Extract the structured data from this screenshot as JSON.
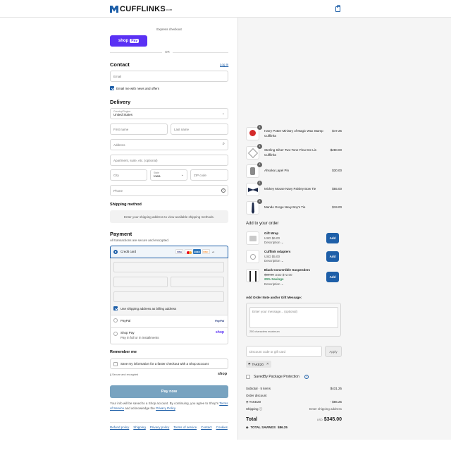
{
  "header": {
    "brand": "CUFFLINKS",
    "trademark": "com",
    "cart_icon": "shopping-bag-icon",
    "brand_color": "#1e5fa8"
  },
  "express": {
    "label": "Express checkout",
    "shop": "shop",
    "pay": "Pay",
    "or": "OR",
    "shop_pay_color": "#5a31f4"
  },
  "contact": {
    "title": "Contact",
    "login": "Log in",
    "email_placeholder": "Email",
    "newsletter": "Email me with news and offers"
  },
  "delivery": {
    "title": "Delivery",
    "country_label": "Country/Region",
    "country": "United States",
    "first_name": "First name",
    "last_name": "Last name",
    "address": "Address",
    "apartment": "Apartment, suite, etc. (optional)",
    "city": "City",
    "state_label": "State",
    "state": "Iowa",
    "zip": "ZIP code",
    "phone": "Phone"
  },
  "shipping": {
    "title": "Shipping method",
    "placeholder": "Enter your shipping address to view available shipping methods."
  },
  "payment": {
    "title": "Payment",
    "subtitle": "All transactions are secure and encrypted.",
    "credit_card": "Credit card",
    "cards": [
      "VISA",
      "MC",
      "AMEX",
      "DISC"
    ],
    "more": "+4",
    "billing": "Use shipping address as billing address",
    "paypal": "PayPal",
    "paypal_logo": "PayPal",
    "shop_pay": "Shop Pay",
    "shop_pay_sub": "Pay in full or in installments",
    "shop_logo": "shop"
  },
  "remember": {
    "title": "Remember me",
    "save": "Save my information for a faster checkout with a Shop account",
    "secure": "Secure and encrypted",
    "shop_logo": "shop"
  },
  "pay_now": "Pay now",
  "legal": {
    "line1": "Your info will be saved to a Shop account. By continuing, you agree to Shop's",
    "terms": "Terms of Service",
    "mid": "and acknowledge the",
    "privacy": "Privacy Policy",
    "end": "."
  },
  "footer": [
    "Refund policy",
    "Shipping",
    "Privacy policy",
    "Terms of service",
    "Contact",
    "Cookies"
  ],
  "order": {
    "items": [
      {
        "name": "Harry Potter Ministry of Magic Wax Stamp",
        "name2": "Cufflinks",
        "qty": "1",
        "price": "$47.25"
      },
      {
        "name": "Sterling Silver Two-Tone Fleur De Lis",
        "name2": "Cufflinks",
        "qty": "1",
        "price": "$280.00"
      },
      {
        "name": "Ahsoka Lapel Pin",
        "name2": "",
        "qty": "1",
        "price": "$30.00"
      },
      {
        "name": "Mickey Mouse Navy Paisley Bow Tie",
        "name2": "",
        "qty": "1",
        "price": "$55.00"
      },
      {
        "name": "Mando Grogu Navy Boy's Tie",
        "name2": "",
        "qty": "1",
        "price": "$19.00"
      }
    ],
    "addons_title": "Add to your order",
    "addons": [
      {
        "name": "Gift Wrap",
        "price": "USD $6.00",
        "old": "",
        "savings": "",
        "desc": "Description",
        "button": "Add"
      },
      {
        "name": "Cufflink Adapters",
        "price": "USD $5.00",
        "old": "",
        "savings": "",
        "desc": "Description",
        "button": "Add"
      },
      {
        "name": "Black Convertible Suspenders",
        "price": "USD $72.00",
        "old": "$90.00",
        "savings": "20% Savings",
        "desc": "Description",
        "button": "Add"
      }
    ],
    "note_title": "Add Order Note and/or Gift Message:",
    "note_placeholder": "Enter your message... (optional)",
    "note_count": "250 characters maximum",
    "discount_placeholder": "Discount code or gift card",
    "apply": "Apply",
    "tag": "TAKE20",
    "protection": "SavedBy Package Protection",
    "subtotal_label": "Subtotal · 5 items",
    "subtotal": "$431.25",
    "order_discount": "Order discount",
    "code": "TAKE20",
    "discount": "- $86.25",
    "shipping_label": "Shipping",
    "shipping_value": "Enter shipping address",
    "total_label": "Total",
    "currency": "USD",
    "total": "$345.00",
    "savings_label": "TOTAL SAVINGS",
    "savings": "$86.25"
  }
}
